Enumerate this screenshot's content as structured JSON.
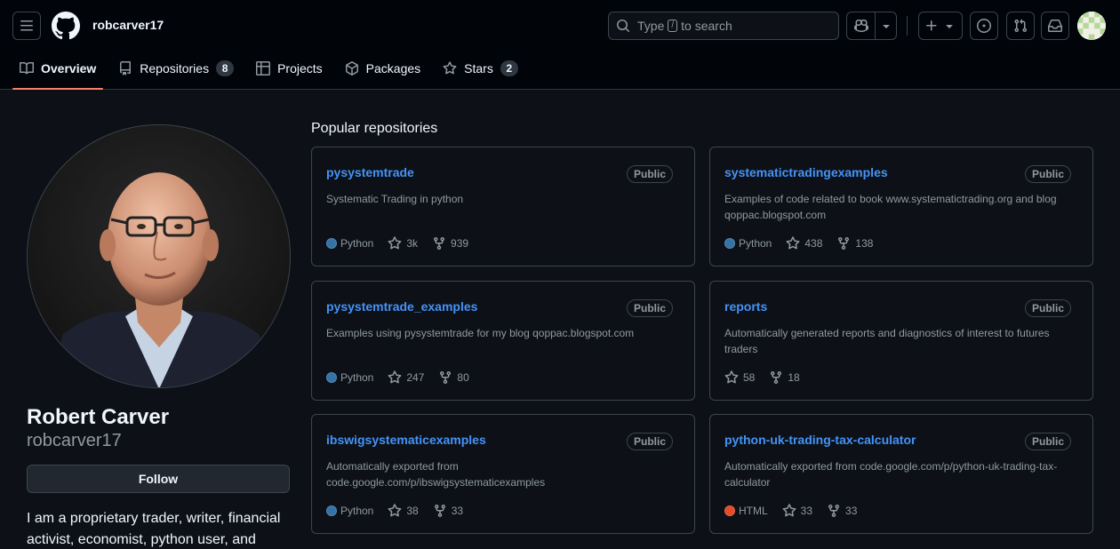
{
  "header": {
    "username": "robcarver17",
    "search_prefix": "Type",
    "search_key": "/",
    "search_suffix": "to search"
  },
  "tabs": [
    {
      "label": "Overview",
      "icon": "book-icon"
    },
    {
      "label": "Repositories",
      "count": "8",
      "icon": "repo-icon"
    },
    {
      "label": "Projects",
      "icon": "table-icon"
    },
    {
      "label": "Packages",
      "icon": "package-icon"
    },
    {
      "label": "Stars",
      "count": "2",
      "icon": "star-icon"
    }
  ],
  "profile": {
    "fullname": "Robert Carver",
    "login": "robcarver17",
    "follow_label": "Follow",
    "bio": "I am a proprietary trader, writer, financial activist, economist, python user, and"
  },
  "popular": {
    "title": "Popular repositories",
    "repos": [
      {
        "name": "pysystemtrade",
        "visibility": "Public",
        "desc": "Systematic Trading in python",
        "lang": "Python",
        "lang_color": "#3572A5",
        "stars": "3k",
        "forks": "939"
      },
      {
        "name": "systematictradingexamples",
        "visibility": "Public",
        "desc": "Examples of code related to book www.systematictrading.org and blog qoppac.blogspot.com",
        "lang": "Python",
        "lang_color": "#3572A5",
        "stars": "438",
        "forks": "138"
      },
      {
        "name": "pysystemtrade_examples",
        "visibility": "Public",
        "desc": "Examples using pysystemtrade for my blog qoppac.blogspot.com",
        "lang": "Python",
        "lang_color": "#3572A5",
        "stars": "247",
        "forks": "80"
      },
      {
        "name": "reports",
        "visibility": "Public",
        "desc": "Automatically generated reports and diagnostics of interest to futures traders",
        "lang": "",
        "lang_color": "",
        "stars": "58",
        "forks": "18"
      },
      {
        "name": "ibswigsystematicexamples",
        "visibility": "Public",
        "desc": "Automatically exported from code.google.com/p/ibswigsystematicexamples",
        "lang": "Python",
        "lang_color": "#3572A5",
        "stars": "38",
        "forks": "33"
      },
      {
        "name": "python-uk-trading-tax-calculator",
        "visibility": "Public",
        "desc": "Automatically exported from code.google.com/p/python-uk-trading-tax-calculator",
        "lang": "HTML",
        "lang_color": "#e34c26",
        "stars": "33",
        "forks": "33"
      }
    ]
  }
}
